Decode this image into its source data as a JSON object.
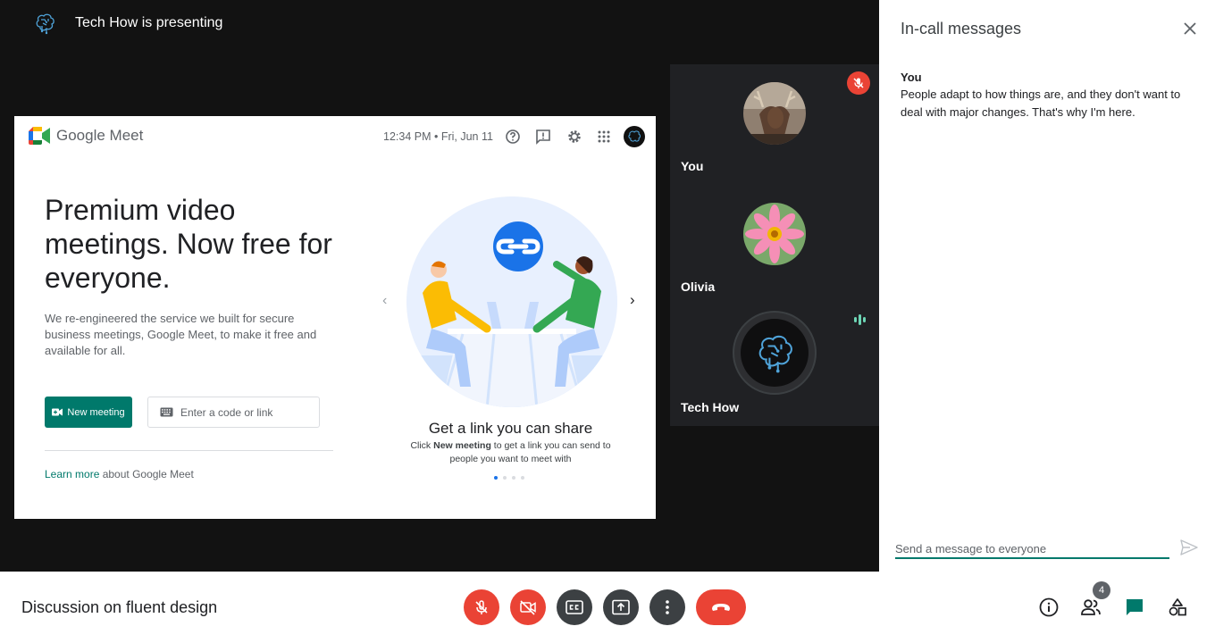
{
  "presenter": {
    "text": "Tech How is presenting"
  },
  "shared_screen": {
    "logo_text": "Google Meet",
    "clock": "12:34 PM • Fri, Jun 11",
    "headline": "Premium video meetings. Now free for everyone.",
    "description": "We re-engineered the service we built for secure business meetings, Google Meet, to make it free and available for all.",
    "new_meeting_label": "New meeting",
    "code_placeholder": "Enter a code or link",
    "learn_more_link": "Learn more",
    "learn_more_rest": " about Google Meet",
    "carousel": {
      "title": "Get a link you can share",
      "desc_pre": "Click ",
      "desc_bold": "New meeting",
      "desc_post": " to get a link you can send to people you want to meet with",
      "active_index": 0,
      "dot_count": 4
    }
  },
  "participants": [
    {
      "name": "You",
      "muted": true
    },
    {
      "name": "Olivia"
    },
    {
      "name": "Tech How",
      "speaking": true
    }
  ],
  "chat": {
    "title": "In-call messages",
    "messages": [
      {
        "sender": "You",
        "text": "People adapt to how things are, and they don't want to deal with major changes. That's why I'm here."
      }
    ],
    "input_placeholder": "Send a message to everyone"
  },
  "bottom_bar": {
    "meeting_name": "Discussion on fluent design",
    "people_count": "4"
  },
  "colors": {
    "accent": "#00796b",
    "danger": "#ea4335",
    "control_dark": "#3c4043",
    "stage_bg": "#121212",
    "tile_bg": "#202124"
  }
}
